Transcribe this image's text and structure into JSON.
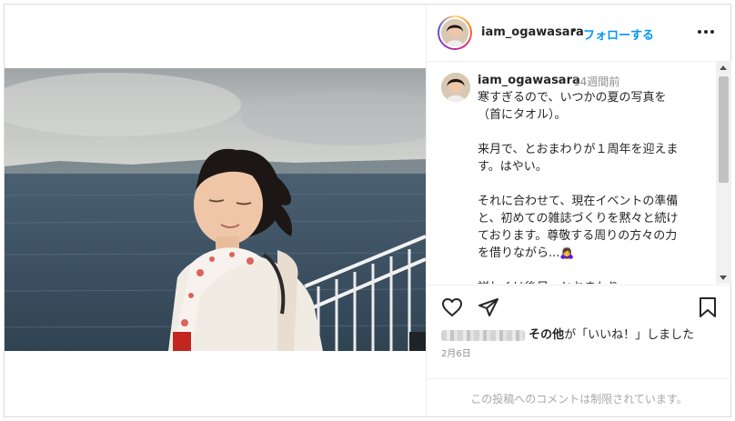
{
  "post": {
    "username": "iam_ogawasara",
    "separator": "•",
    "follow_label": "フォローする",
    "more_icon": "more-horizontal-icon"
  },
  "caption": {
    "username": "iam_ogawasara",
    "time_ago": "14週間前",
    "text": "寒すぎるので、いつかの夏の写真を\n（首にタオル）。\n\n来月で、とおまわりが１周年を迎えま\nす。はやい。\n\nそれに合わせて、現在イベントの準備\nと、初めての雑誌づくりを黙々と続け\nております。尊敬する周りの方々の力\nを借りながら...🙇‍♀️\n\n詳しくは後日、とおまわり"
  },
  "actions": {
    "like_icon": "heart-icon",
    "share_icon": "paper-plane-icon",
    "save_icon": "bookmark-icon"
  },
  "likes": {
    "others_label": "その他",
    "suffix": "が「いいね！」しました"
  },
  "date": "2月6日",
  "footer": {
    "comments_disabled": "この投稿へのコメントは制限されています。"
  }
}
